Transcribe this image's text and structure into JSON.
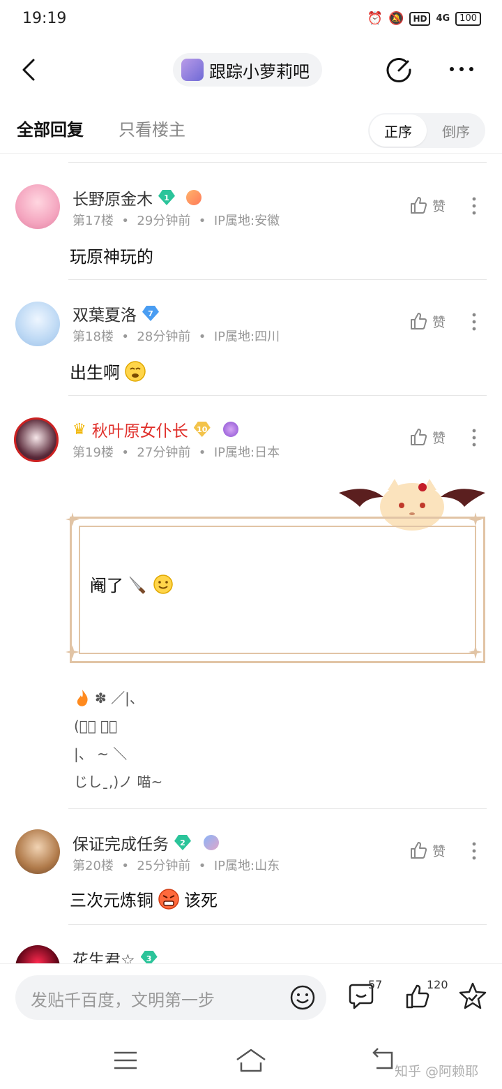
{
  "status_bar": {
    "time": "19:19",
    "network": "4G",
    "hd": "HD",
    "battery": "100"
  },
  "header": {
    "forum_name": "跟踪小萝莉吧"
  },
  "tabs": {
    "all_replies": "全部回复",
    "owner_only": "只看楼主",
    "sort_asc": "正序",
    "sort_desc": "倒序"
  },
  "like_label": "赞",
  "posts": [
    {
      "name": "长野原金木",
      "level": "1",
      "floor": "第17楼",
      "time": "29分钟前",
      "ip": "IP属地:安徽",
      "content": "玩原神玩的"
    },
    {
      "name": "双葉夏洛",
      "level": "7",
      "floor": "第18楼",
      "time": "28分钟前",
      "ip": "IP属地:四川",
      "content": "出生啊"
    },
    {
      "name": "秋叶原女仆长",
      "level": "10",
      "floor": "第19楼",
      "time": "27分钟前",
      "ip": "IP属地:日本",
      "content": "阉了",
      "kaomoji": [
        "✽ ／|、",
        "(ﾟ､ 。７",
        "|、 ~ ＼",
        "じしˍ,)ノ 喵~"
      ]
    },
    {
      "name": "保证完成任务",
      "level": "2",
      "floor": "第20楼",
      "time": "25分钟前",
      "ip": "IP属地:山东",
      "content": "三次元炼铜",
      "content_suffix": "该死"
    },
    {
      "name": "花生君☆",
      "level": "3"
    }
  ],
  "bottom_bar": {
    "placeholder": "发贴千百度，文明第一步",
    "comment_count": "57",
    "like_count": "120"
  },
  "watermark": "知乎 @阿赖耶",
  "colors": {
    "accent_green": "#2bc49a",
    "accent_blue": "#4a9df2",
    "vip_red": "#e0312c",
    "frame": "#e1c4a5"
  }
}
